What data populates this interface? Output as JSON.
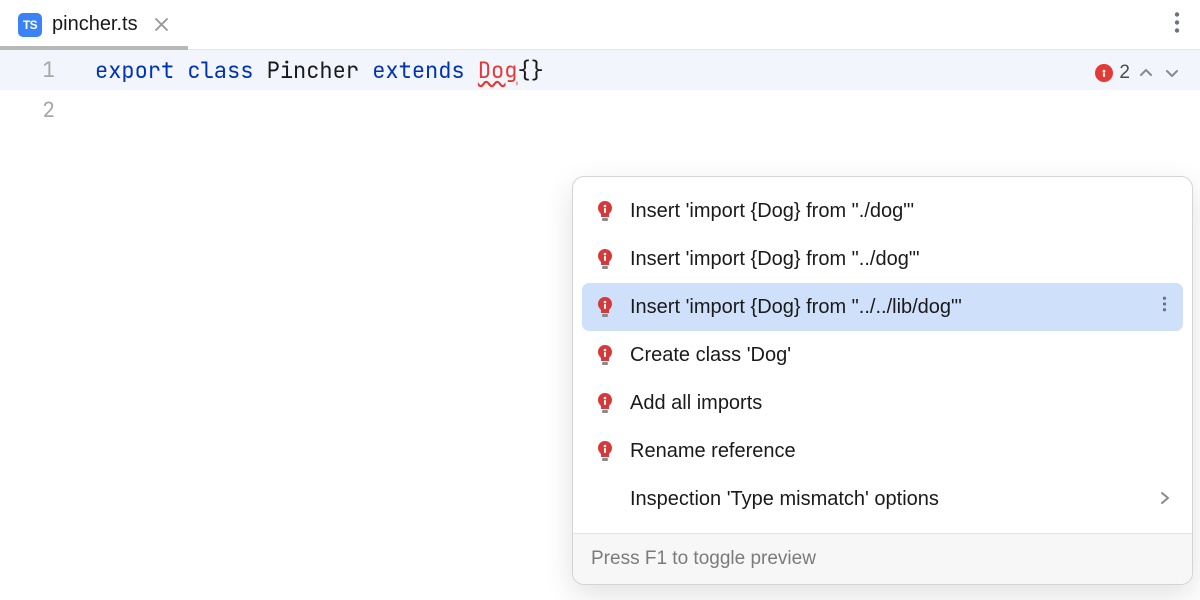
{
  "tab": {
    "filename": "pincher.ts",
    "icon_label": "TS"
  },
  "editor": {
    "error_count": "2",
    "lines": {
      "l1_number": "1",
      "l1_kw_export": "export",
      "l1_kw_class": "class",
      "l1_ident": "Pincher",
      "l1_kw_extends": "extends",
      "l1_err": "Dog",
      "l1_braces": "{}",
      "l2_number": "2"
    }
  },
  "popup": {
    "items": [
      {
        "label": "Insert 'import {Dog} from \"./dog\"'"
      },
      {
        "label": "Insert 'import {Dog} from \"../dog\"'"
      },
      {
        "label": "Insert 'import {Dog} from \"../../lib/dog\"'"
      },
      {
        "label": "Create class 'Dog'"
      },
      {
        "label": "Add all imports"
      },
      {
        "label": "Rename reference"
      }
    ],
    "options_label": "Inspection 'Type mismatch' options",
    "footer": "Press F1 to toggle preview"
  }
}
